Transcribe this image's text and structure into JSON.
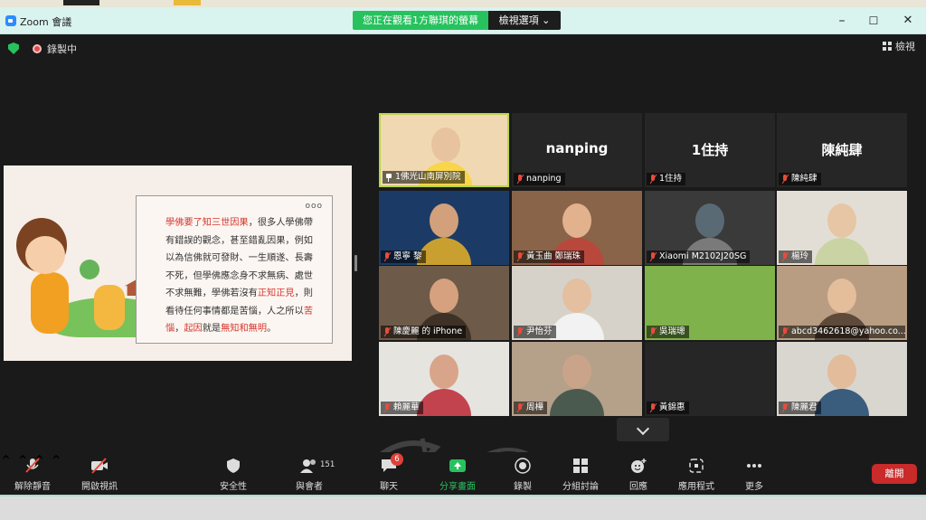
{
  "window": {
    "app_title": "Zoom 會議",
    "share_banner": "您正在觀看1方聯琪的螢幕",
    "view_options": "檢視選項 ⌄",
    "minimize": "–",
    "maximize": "☐",
    "close": "✕"
  },
  "meeting": {
    "recording_text": "錄製中",
    "view_button": "檢視"
  },
  "slide": {
    "dots": "ooo",
    "lines": [
      [
        {
          "t": "學佛要了知三世因果",
          "c": "red"
        },
        {
          "t": "，很多人學佛帶",
          "c": ""
        }
      ],
      [
        {
          "t": "有錯誤的觀念，甚至錯亂因果，例如",
          "c": ""
        }
      ],
      [
        {
          "t": "以為信佛就可發財、一生順遂、長壽",
          "c": ""
        }
      ],
      [
        {
          "t": "不死，但學佛應念身不求無病、處世",
          "c": ""
        }
      ],
      [
        {
          "t": "不求無難，學佛若沒有",
          "c": ""
        },
        {
          "t": "正知正見",
          "c": "red"
        },
        {
          "t": "，則",
          "c": ""
        }
      ],
      [
        {
          "t": "看待任何事情都是苦惱，人之所以",
          "c": ""
        },
        {
          "t": "苦",
          "c": "red"
        }
      ],
      [
        {
          "t": "惱",
          "c": "red"
        },
        {
          "t": "，",
          "c": ""
        },
        {
          "t": "起因",
          "c": "red"
        },
        {
          "t": "就是",
          "c": ""
        },
        {
          "t": "無知和無明",
          "c": "red"
        },
        {
          "t": "。",
          "c": ""
        }
      ]
    ]
  },
  "participants": [
    {
      "name": "1佛光山南屏別院",
      "icon": "pin",
      "video": true,
      "bg": "#f0d9b2",
      "skin": "#e8c3a0",
      "extra": "#f8d54a"
    },
    {
      "name": "nanping",
      "icon": "mic",
      "video": false,
      "big": "nanping"
    },
    {
      "name": "1住持",
      "icon": "mic",
      "video": false,
      "big": "1住持"
    },
    {
      "name": "陳純肆",
      "icon": "mic",
      "video": false,
      "big": "陳純肆"
    },
    {
      "name": "恩寧 黎",
      "icon": "mic",
      "video": true,
      "bg": "#1b3b66",
      "skin": "#d2a07a",
      "extra": "#c9a030"
    },
    {
      "name": "黃玉曲 鄭瑞珠",
      "icon": "mic",
      "video": true,
      "bg": "#8a6448",
      "skin": "#e2b28f",
      "extra": "#b9483c"
    },
    {
      "name": "Xiaomi M2102J20SG",
      "icon": "mic",
      "video": true,
      "bg": "#3a3a3a",
      "skin": "#5a6a74",
      "extra": "#7a7a7a"
    },
    {
      "name": "楊玲",
      "icon": "mic",
      "video": true,
      "bg": "#e3ded5",
      "skin": "#e6c6a4",
      "extra": "#c9d3a4"
    },
    {
      "name": "陳慶麗 的 iPhone",
      "icon": "mic",
      "video": true,
      "bg": "#6d5a48",
      "skin": "#d6a17e",
      "extra": "#3e3126"
    },
    {
      "name": "尹怡芬",
      "icon": "mic",
      "video": true,
      "bg": "#d7d2c9",
      "skin": "#e4bfa0",
      "extra": "#f2f2f2"
    },
    {
      "name": "吳瑞璁",
      "icon": "mic",
      "video": true,
      "bg": "#7fb24a",
      "skin": "#7fb24a",
      "extra": "#7fb24a"
    },
    {
      "name": "abcd3462618@yahoo.co...",
      "icon": "mic",
      "video": true,
      "bg": "#b99d82",
      "skin": "#e4bd9a",
      "extra": "#5e4a3a"
    },
    {
      "name": "賴麗華",
      "icon": "mic",
      "video": true,
      "bg": "#e6e4df",
      "skin": "#d8a58a",
      "extra": "#c2434e"
    },
    {
      "name": "周樺",
      "icon": "mic",
      "video": true,
      "bg": "#b5a08a",
      "skin": "#caa48a",
      "extra": "#4b5a4f"
    },
    {
      "name": "黃錦惠",
      "icon": "mic",
      "video": false,
      "big": ""
    },
    {
      "name": "陳麗君",
      "icon": "mic",
      "video": true,
      "bg": "#d9d6cf",
      "skin": "#e2bc9b",
      "extra": "#3a5d7e"
    }
  ],
  "toolbar": {
    "mute": "解除靜音",
    "video": "開啟視訊",
    "security": "安全性",
    "participants": "與會者",
    "participant_count": "151",
    "chat": "聊天",
    "chat_badge": "6",
    "share": "分享畫面",
    "record": "錄製",
    "breakout": "分組討論",
    "reactions": "回應",
    "apps": "應用程式",
    "more": "更多",
    "leave": "離開"
  },
  "colors": {
    "accent_green": "#27c25e",
    "leave_red": "#c92a2a",
    "active_speaker": "#b8d64a"
  }
}
